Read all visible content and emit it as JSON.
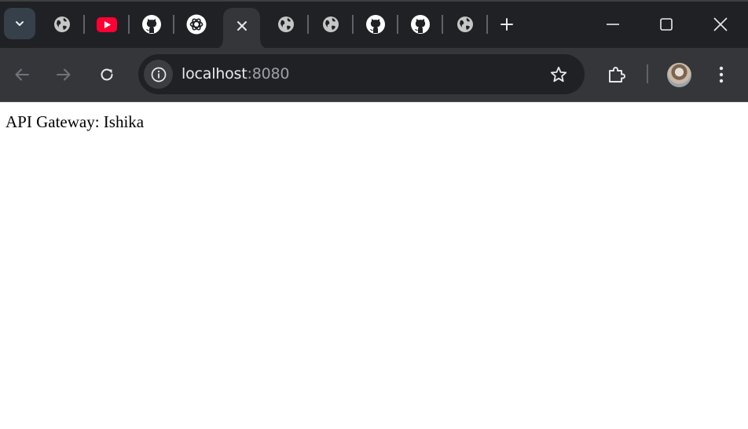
{
  "browser": {
    "tabs": [
      {
        "icon": "globe-icon"
      },
      {
        "icon": "youtube-icon"
      },
      {
        "icon": "github-icon"
      },
      {
        "icon": "chatgpt-icon"
      },
      {
        "icon": "close-icon",
        "active": true
      },
      {
        "icon": "globe-icon"
      },
      {
        "icon": "globe-icon"
      },
      {
        "icon": "github-icon"
      },
      {
        "icon": "github-icon"
      },
      {
        "icon": "globe-icon"
      }
    ],
    "address": {
      "host": "localhost",
      "port": ":8080"
    }
  },
  "colors": {
    "tabstrip_bg": "#202124",
    "toolbar_bg": "#35363a",
    "omnibox_bg": "#202124",
    "youtube_red": "#ff0033",
    "icon_fg": "#c4c7c5"
  },
  "page": {
    "text": "API Gateway: Ishika"
  }
}
